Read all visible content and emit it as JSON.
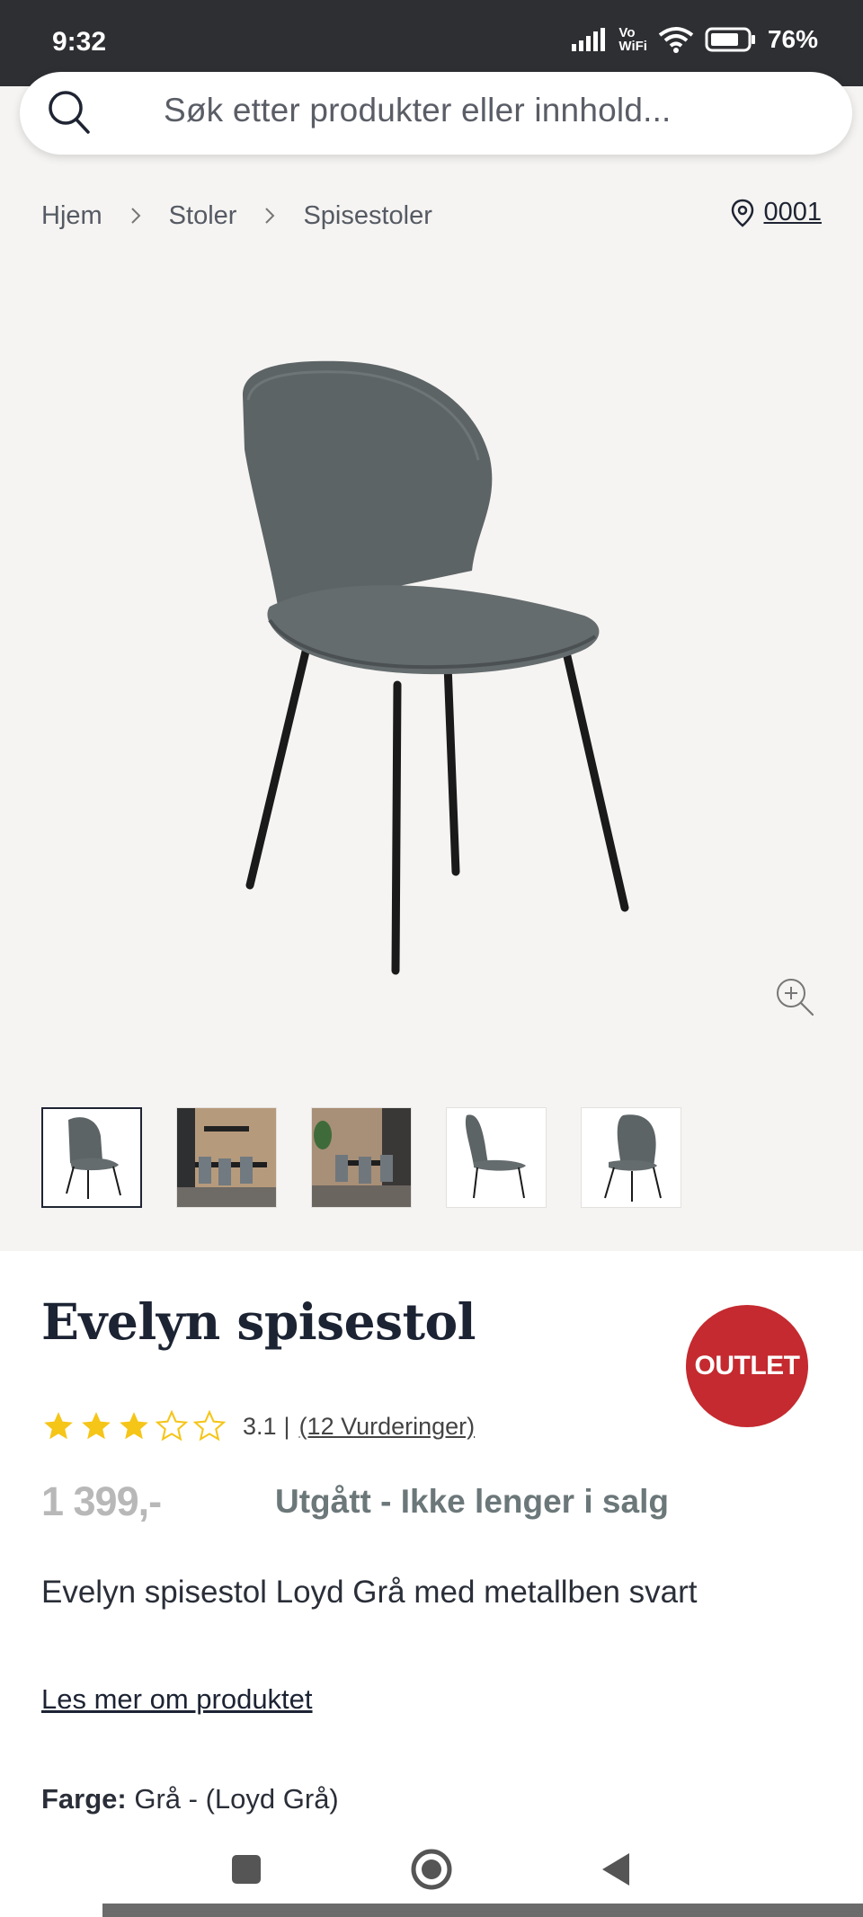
{
  "status_bar": {
    "time": "9:32",
    "network_label_top": "Vo",
    "network_label_bottom": "WiFi",
    "battery": "76%"
  },
  "search": {
    "placeholder": "Søk etter produkter eller innhold..."
  },
  "breadcrumb": {
    "items": [
      "Hjem",
      "Stoler",
      "Spisestoler"
    ],
    "store_code": "0001"
  },
  "gallery": {
    "thumbnail_count": 5,
    "active_index": 0
  },
  "product": {
    "title": "Evelyn spisestol",
    "badge": "OUTLET",
    "rating_value": "3.1",
    "rating_stars": 3,
    "rating_max": 5,
    "rating_count": "(12 Vurderinger)",
    "price": "1 399,-",
    "availability": "Utgått - Ikke lenger i salg",
    "description": "Evelyn spisestol Loyd Grå med metallben svart",
    "read_more": "Les mer om produktet",
    "color_label": "Farge:",
    "color_value": "Grå - (Loyd Grå)"
  },
  "colors": {
    "badge": "#c42a2f",
    "star": "#f5c518",
    "availability": "#6b7779",
    "price": "#b8b8b8"
  }
}
